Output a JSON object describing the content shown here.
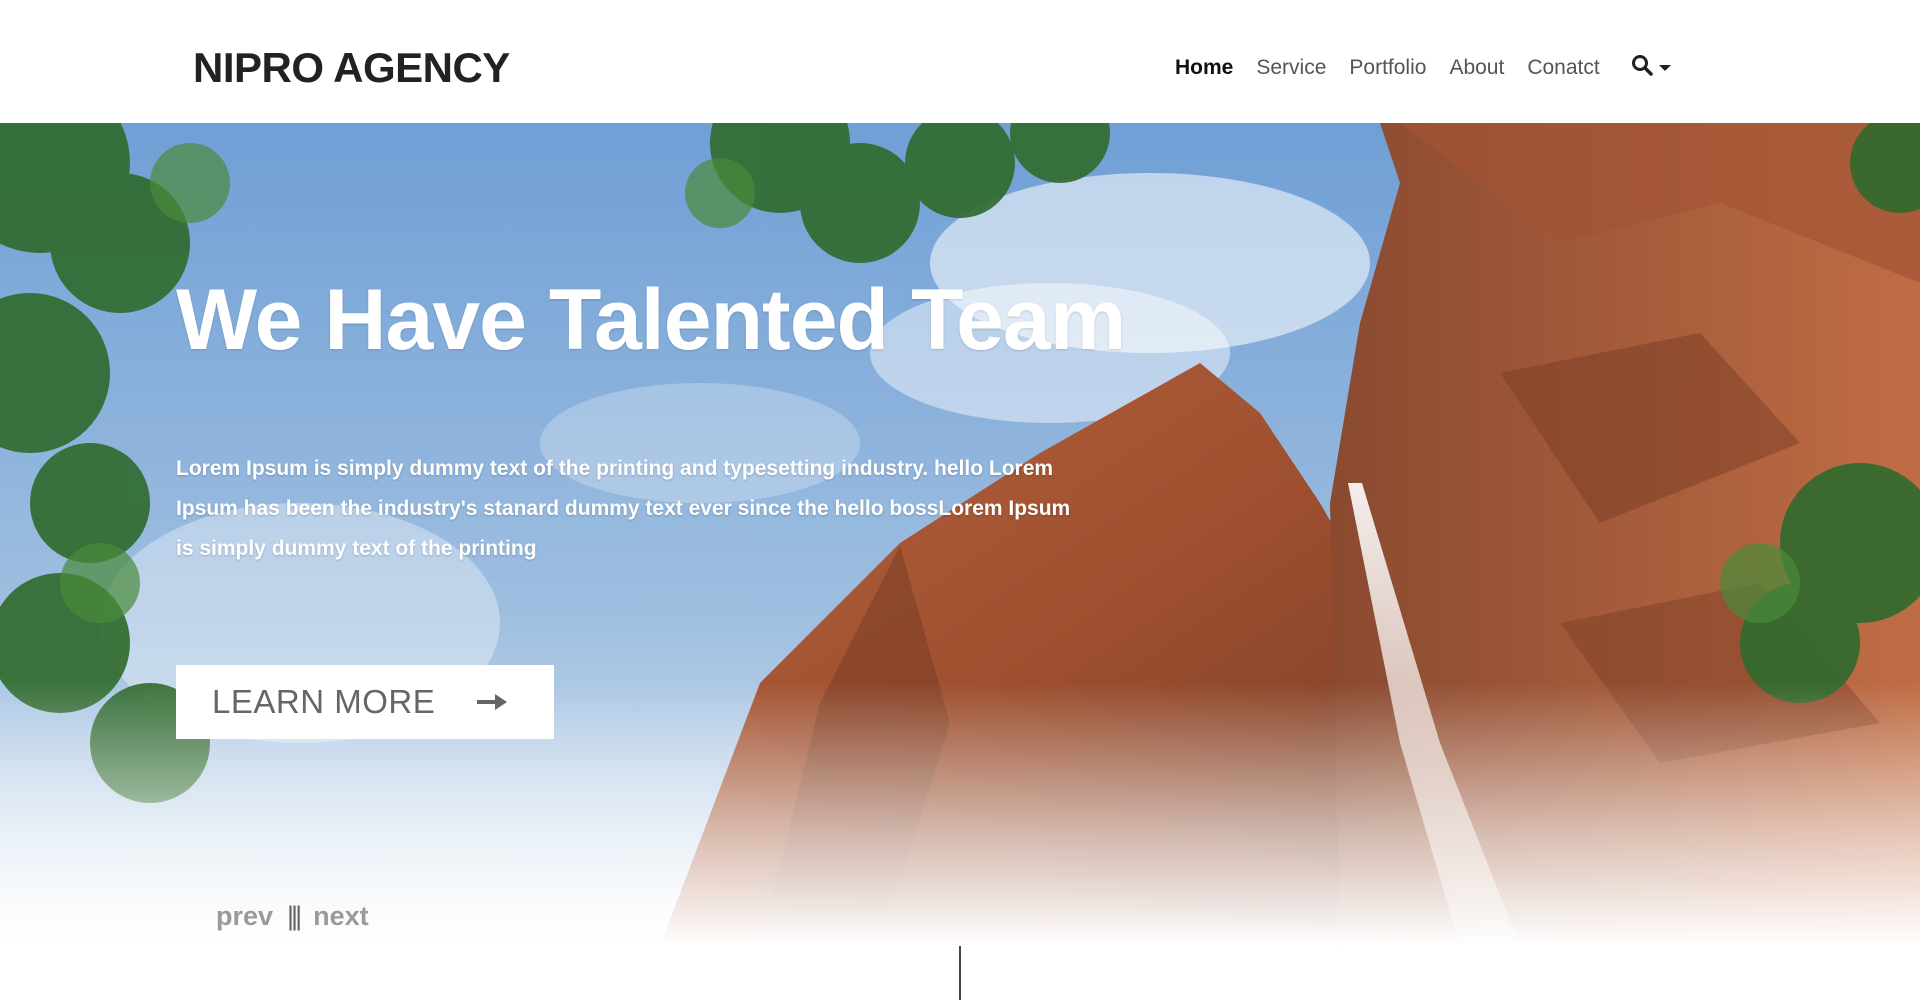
{
  "brand": {
    "logo": "NIPRO AGENCY"
  },
  "nav": {
    "items": [
      {
        "label": "Home",
        "active": true
      },
      {
        "label": "Service",
        "active": false
      },
      {
        "label": "Portfolio",
        "active": false
      },
      {
        "label": "About",
        "active": false
      },
      {
        "label": "Conatct",
        "active": false
      }
    ],
    "search_icon": "search-icon",
    "dropdown_icon": "caret-down-icon"
  },
  "hero": {
    "title": "We Have Talented Team",
    "text": "Lorem Ipsum is simply dummy text of the printing and typesetting industry. hello Lorem Ipsum has been the industry's stanard dummy text ever since the hello bossLorem Ipsum is simply dummy text of the printing",
    "button_label": "LEARN MORE",
    "button_icon": "arrow-right-icon",
    "pager": {
      "prev": "prev",
      "separator": "|||",
      "next": "next"
    }
  },
  "colors": {
    "sky": "#5d8cc4",
    "rock": "#a65a3a",
    "foliage": "#2f6a2c",
    "text_dark": "#222222"
  }
}
